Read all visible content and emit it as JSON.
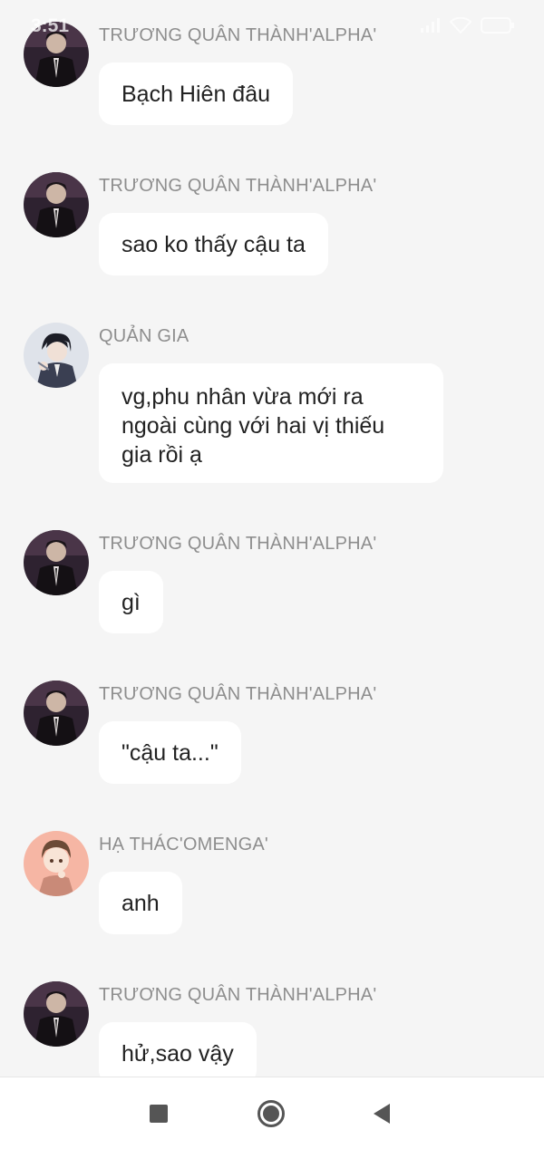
{
  "status_bar": {
    "time": "3:51",
    "icons": [
      "signal-icon",
      "wifi-icon",
      "battery-icon"
    ]
  },
  "messages": [
    {
      "sender": "TRƯƠNG QUÂN THÀNH'ALPHA'",
      "text": "Bạch Hiên đâu",
      "avatar": "dark-suit-avatar"
    },
    {
      "sender": "TRƯƠNG QUÂN THÀNH'ALPHA'",
      "text": "sao ko thấy cậu ta",
      "avatar": "dark-suit-avatar"
    },
    {
      "sender": "QUẢN GIA",
      "text": "vg,phu nhân vừa mới ra ngoài cùng với hai vị thiếu gia rồi ạ",
      "avatar": "butler-avatar"
    },
    {
      "sender": "TRƯƠNG QUÂN THÀNH'ALPHA'",
      "text": "gì",
      "avatar": "dark-suit-avatar"
    },
    {
      "sender": "TRƯƠNG QUÂN THÀNH'ALPHA'",
      "text": "\"cậu ta...\"",
      "avatar": "dark-suit-avatar"
    },
    {
      "sender": "HẠ THÁC'OMENGA'",
      "text": "anh",
      "avatar": "brown-hair-avatar"
    },
    {
      "sender": "TRƯƠNG QUÂN THÀNH'ALPHA'",
      "text": "hử,sao vậy",
      "avatar": "dark-suit-avatar"
    }
  ],
  "nav_bar": {
    "buttons": [
      "recents-square-icon",
      "home-circle-icon",
      "back-triangle-icon"
    ]
  },
  "colors": {
    "background": "#f5f5f5",
    "bubble": "#ffffff",
    "sender_text": "#8e8e8e",
    "message_text": "#222222"
  }
}
